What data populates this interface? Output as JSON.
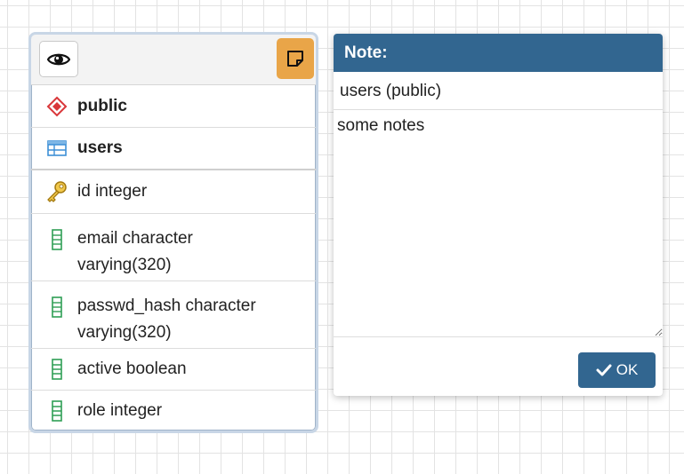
{
  "table_node": {
    "toolbar": {
      "toggle_icon": "eye-icon",
      "note_icon": "sticky-note-icon",
      "note_button_color": "#e9a548"
    },
    "schema": {
      "icon": "schema-diamond-icon",
      "label": "public"
    },
    "table": {
      "icon": "table-icon",
      "label": "users"
    },
    "columns": [
      {
        "icon": "primary-key-icon",
        "label": "id integer"
      },
      {
        "icon": "column-icon",
        "label": "email character varying(320)"
      },
      {
        "icon": "column-icon",
        "label": "passwd_hash character varying(320)"
      },
      {
        "icon": "column-icon",
        "label": "active boolean"
      },
      {
        "icon": "column-icon",
        "label": "role integer"
      }
    ]
  },
  "note_dialog": {
    "title": "Note:",
    "subtitle": "users (public)",
    "text": "some notes",
    "ok_label": "OK",
    "header_color": "#326690"
  }
}
